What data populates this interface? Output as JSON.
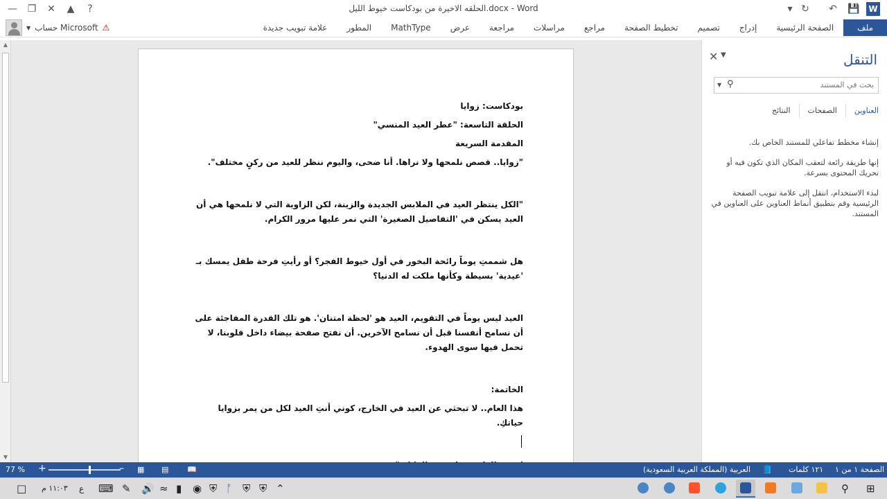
{
  "window": {
    "title": "الحلقه الاخيرة من بودكاست خيوط الليل.docx - Word"
  },
  "ribbon": {
    "tabs": [
      "ملف",
      "الصفحة الرئيسية",
      "إدراج",
      "تصميم",
      "تخطيط الصفحة",
      "مراجع",
      "مراسلات",
      "مراجعة",
      "عرض",
      "MathType",
      "المطور",
      "علامة تبويب جديدة"
    ],
    "account_label": "حساب Microsoft"
  },
  "document": {
    "paragraphs": [
      "بودكاست: زوايا",
      "الحلقة التاسعة: \"عطر العيد المنسي\"",
      "المقدمة السريعة",
      "\"زوايا.. قصص نلمحها ولا نراها. أنا ضحى، واليوم ننظر للعيد من ركنٍ مختلف\".",
      "\"الكل ينتظر العيد في الملابس الجديدة والزينة، لكن الزاوية التي لا نلمحها هي أن العيد يسكن في 'التفاصيل الصغيرة' التي نمر عليها مرور الكرام.",
      "هل شممتِ يوماً رائحة البخور في أول خيوط الفجر؟ أو رأيتِ فرحة طفل يمسك بـ 'عيدية' بسيطة وكأنها ملكت له الدنيا؟",
      "العيد ليس يوماً في التقويم، العيد هو 'لحظة امتنان'. هو تلك القدرة المفاجئة على أن نسامح أنفسنا قبل أن نسامح الآخرين. أن نفتح صفحة بيضاء داخل قلوبنا، لا تحمل فيها سوى الهدوء.",
      "الخاتمة:",
      "هذا العام.. لا تبحثي عن العيد في الخارج، كوني أنتِ العيد لكل من يمر بزوايا حياتكِ.",
      "انتهت الزاوية، ولم تنتهِ الحكاية\"."
    ]
  },
  "navigation": {
    "title": "التنقل",
    "search_placeholder": "بحث في المستند",
    "tabs": [
      "العناوين",
      "الصفحات",
      "النتائج"
    ],
    "info": [
      "إنشاء مخطط تفاعلي للمستند الخاص بك.",
      "إنها طريقة رائعة لتعقب المكان الذي تكون فيه أو تحريك المحتوى بسرعة.",
      "لبدء الاستخدام، انتقل إلى علامة تبويب الصفحة الرئيسية وقم بتطبيق أنماط العناوين على العناوين في المستند."
    ]
  },
  "statusbar": {
    "page": "الصفحة ١ من ١",
    "words": "١٢١ كلمات",
    "language": "العربية (المملكة العربية السعودية)",
    "zoom": "77 %"
  },
  "taskbar": {
    "time": "١١:٠٣ م",
    "input_lang": "ع"
  },
  "colors": {
    "accent": "#2b579a",
    "statusbar": "#2b579a"
  }
}
